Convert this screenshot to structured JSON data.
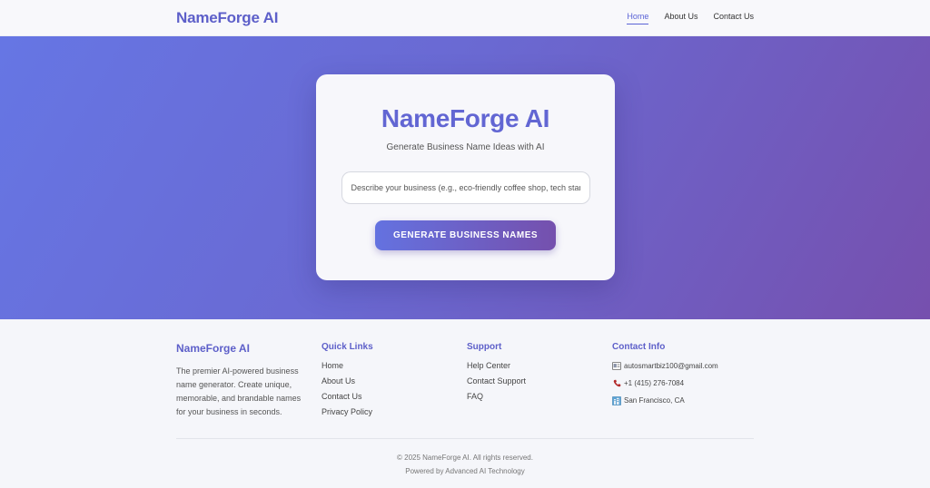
{
  "navbar": {
    "brand": "NameForge AI",
    "links": [
      {
        "label": "Home",
        "active": true
      },
      {
        "label": "About Us",
        "active": false
      },
      {
        "label": "Contact Us",
        "active": false
      }
    ]
  },
  "hero": {
    "title": "NameForge AI",
    "subtitle": "Generate Business Name Ideas with AI",
    "input_placeholder": "Describe your business (e.g., eco-friendly coffee shop, tech startup)",
    "input_value": "",
    "button_label": "GENERATE BUSINESS NAMES"
  },
  "footer": {
    "brand_title": "NameForge AI",
    "brand_description": "The premier AI-powered business name generator. Create unique, memorable, and brandable names for your business in seconds.",
    "quick_links": {
      "title": "Quick Links",
      "items": [
        "Home",
        "About Us",
        "Contact Us",
        "Privacy Policy"
      ]
    },
    "support": {
      "title": "Support",
      "items": [
        "Help Center",
        "Contact Support",
        "FAQ"
      ]
    },
    "contact": {
      "title": "Contact Info",
      "email": "autosmartbiz100@gmail.com",
      "phone": "+1 (415) 276-7084",
      "location": "San Francisco, CA",
      "icons": [
        "email-icon",
        "phone-icon",
        "location-icon"
      ]
    },
    "copyright": "© 2025 NameForge AI. All rights reserved.",
    "powered_by": "Powered by Advanced AI Technology"
  },
  "colors": {
    "accent": "#5d5fc9",
    "gradient_start": "#6676e4",
    "gradient_end": "#7650ae"
  }
}
